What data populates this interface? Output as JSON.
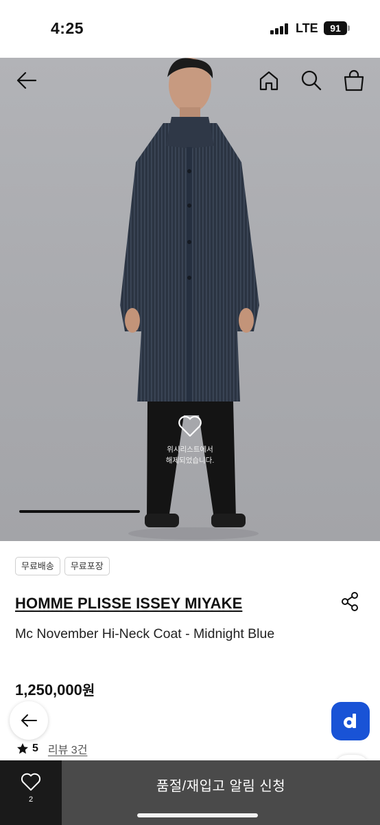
{
  "status_bar": {
    "time": "4:25",
    "network": "LTE",
    "battery": "91"
  },
  "hero": {
    "icons": [
      "back-arrow-icon",
      "home-icon",
      "search-icon",
      "shopping-bag-icon"
    ],
    "wishlist_message_line1": "위시리스트에서",
    "wishlist_message_line2": "해제되었습니다.",
    "gallery_progress": 1.0
  },
  "product": {
    "tags": [
      "무료배송",
      "무료포장"
    ],
    "brand": "HOMME PLISSE ISSEY MIYAKE",
    "name": "Mc November Hi-Neck Coat - Midnight Blue",
    "price": "1,250,000",
    "price_unit": "원",
    "rating": "5",
    "review_label": "리뷰 3건"
  },
  "floating": {
    "d_label": "d"
  },
  "bottom_bar": {
    "wish_count": "2",
    "restock_label": "품절/재입고 알림 신청"
  },
  "colors": {
    "brand_blue": "#1953d6",
    "bottom_bar": "#4a4a4a",
    "wish_button": "#1a1a1a"
  }
}
